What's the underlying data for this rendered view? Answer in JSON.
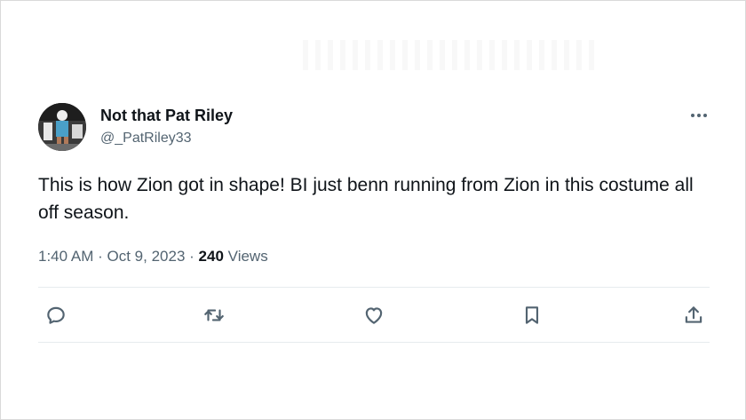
{
  "tweet": {
    "author": {
      "display_name": "Not that Pat Riley",
      "handle": "@_PatRiley33"
    },
    "text": "This is how Zion got in shape! BI just benn running from Zion in this costume all off season.",
    "time": "1:40 AM",
    "separator": "·",
    "date": "Oct 9, 2023",
    "views_count": "240",
    "views_label": "Views"
  },
  "icons": {
    "more": "more-horizontal-icon",
    "reply": "reply-icon",
    "retweet": "retweet-icon",
    "like": "heart-icon",
    "bookmark": "bookmark-icon",
    "share": "share-icon"
  },
  "colors": {
    "text_primary": "#0f1419",
    "text_secondary": "#536471",
    "divider": "#e6ebee",
    "icon": "#536471"
  }
}
